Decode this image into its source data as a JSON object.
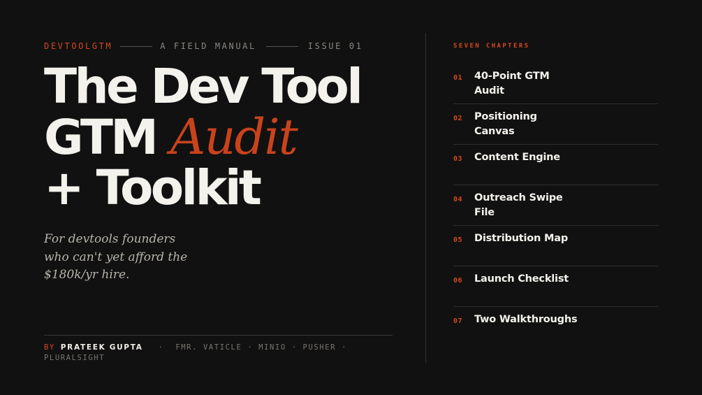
{
  "header": {
    "brand": "DEVTOOLGTM",
    "tagline": "A FIELD MANUAL",
    "issue": "ISSUE 01"
  },
  "title": {
    "line1": "The Dev Tool",
    "line2_plain": "GTM",
    "line2_accent": "Audit",
    "line3": "+ Toolkit"
  },
  "subtitle": {
    "line1": "For devtools founders",
    "line2": "who can't yet afford the",
    "line3": "$180k/yr hire."
  },
  "byline": {
    "by": "BY",
    "author": "PRATEEK GUPTA",
    "separator": "·",
    "credentials": "FMR. VATICLE · MINIO · PUSHER · PLURALSIGHT"
  },
  "toc": {
    "heading": "SEVEN CHAPTERS",
    "items": [
      {
        "num": "01",
        "label": "40-Point GTM Audit"
      },
      {
        "num": "02",
        "label": "Positioning Canvas"
      },
      {
        "num": "03",
        "label": "Content Engine"
      },
      {
        "num": "04",
        "label": "Outreach Swipe File"
      },
      {
        "num": "05",
        "label": "Distribution Map"
      },
      {
        "num": "06",
        "label": "Launch Checklist"
      },
      {
        "num": "07",
        "label": "Two Walkthroughs"
      }
    ]
  },
  "colors": {
    "background": "#111111",
    "accent": "#c8431c",
    "text": "#f4f2ec",
    "muted": "#8a8782"
  }
}
